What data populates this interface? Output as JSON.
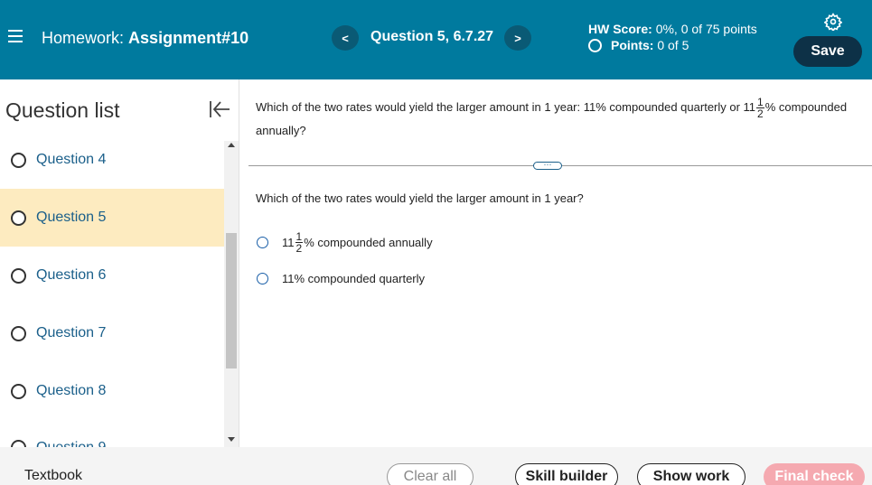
{
  "header": {
    "hw_prefix": "Homework:",
    "hw_name": "Assignment#10",
    "prev_label": "<",
    "next_label": ">",
    "question_label": "Question 5, 6.7.27",
    "hw_score_label": "HW Score:",
    "hw_score_value": "0%, 0 of 75 points",
    "points_label": "Points:",
    "points_value": "0 of 5",
    "save_label": "Save"
  },
  "sidebar": {
    "title": "Question list",
    "items": [
      {
        "label": "Question 4",
        "active": false
      },
      {
        "label": "Question 5",
        "active": true
      },
      {
        "label": "Question 6",
        "active": false
      },
      {
        "label": "Question 7",
        "active": false
      },
      {
        "label": "Question 8",
        "active": false
      },
      {
        "label": "Question 9",
        "active": false
      }
    ]
  },
  "main": {
    "question_part1": "Which of the two rates would yield the larger amount in 1 year: 11% compounded quarterly or 11",
    "question_frac_num": "1",
    "question_frac_den": "2",
    "question_part2": "% compounded annually?",
    "expand_label": "···",
    "sub_question": "Which of the two rates would yield the larger amount in 1 year?",
    "option1_whole": "11",
    "option1_frac_num": "1",
    "option1_frac_den": "2",
    "option1_rest": "% compounded annually",
    "option2": "11% compounded quarterly"
  },
  "footer": {
    "textbook": "Textbook",
    "clear_all": "Clear all",
    "skill_builder": "Skill builder",
    "show_work": "Show work",
    "final_check": "Final check"
  },
  "colors": {
    "header_bg": "#007a9e",
    "save_bg": "#0d3147",
    "active_item_bg": "#fdebc0",
    "link_blue": "#1a5f8a",
    "final_check_bg": "#f5a9b0"
  }
}
